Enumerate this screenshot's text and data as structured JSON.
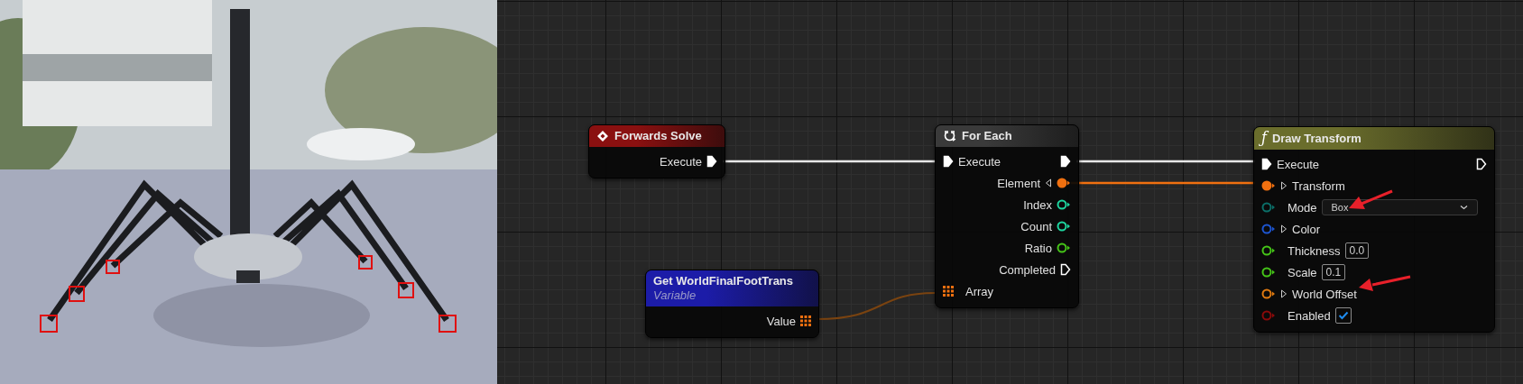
{
  "graph": {
    "nodes": [
      {
        "kind": "event",
        "title": "Forwards Solve",
        "color": "#8a1010",
        "rows": [
          {
            "right": {
              "kind": "exec",
              "label": "Execute",
              "connected": true
            }
          }
        ]
      },
      {
        "kind": "variable",
        "title": "Get WorldFinalFootTrans",
        "subtitle": "Variable",
        "color": "#1c1ca8",
        "rows": [
          {
            "right": {
              "kind": "array",
              "label": "Value",
              "connected": true,
              "color": "#f07010"
            }
          }
        ]
      },
      {
        "kind": "loop",
        "title": "For Each",
        "color": "#3a3a3a",
        "rows": [
          {
            "left": {
              "kind": "exec",
              "label": "Execute",
              "connected": true
            },
            "right": {
              "kind": "exec",
              "connected": true
            }
          },
          {
            "right": {
              "kind": "data",
              "label": "Element",
              "connected": true,
              "expanded": false,
              "color": "#f07010"
            }
          },
          {
            "right": {
              "kind": "data",
              "label": "Index",
              "connected": false,
              "color": "#1ed6a0"
            }
          },
          {
            "right": {
              "kind": "data",
              "label": "Count",
              "connected": false,
              "color": "#1ed6a0"
            }
          },
          {
            "right": {
              "kind": "data",
              "label": "Ratio",
              "connected": false,
              "color": "#45c418"
            }
          },
          {
            "right": {
              "kind": "exec",
              "label": "Completed",
              "connected": false
            }
          },
          {
            "left": {
              "kind": "array",
              "label": "Array",
              "connected": true,
              "color": "#f07010"
            }
          }
        ]
      },
      {
        "kind": "function",
        "glyph": "ƒ",
        "title": "Draw Transform",
        "color": "#6a6d2c",
        "rows": [
          {
            "left": {
              "kind": "exec",
              "label": "Execute",
              "connected": true
            },
            "right": {
              "kind": "exec",
              "connected": false
            }
          },
          {
            "left": {
              "kind": "data",
              "label": "Transform",
              "connected": true,
              "expanded": false,
              "color": "#f07010"
            }
          },
          {
            "left": {
              "kind": "data",
              "label": "Mode",
              "connected": false,
              "color": "#0b6e68",
              "dropdown": "Box"
            }
          },
          {
            "left": {
              "kind": "data",
              "label": "Color",
              "connected": false,
              "expanded": false,
              "color": "#1d55d0"
            }
          },
          {
            "left": {
              "kind": "data",
              "label": "Thickness",
              "connected": false,
              "color": "#45c418",
              "value": "0.0"
            }
          },
          {
            "left": {
              "kind": "data",
              "label": "Scale",
              "connected": false,
              "color": "#45c418",
              "value": "0.1"
            }
          },
          {
            "left": {
              "kind": "data",
              "label": "World Offset",
              "connected": false,
              "expanded": false,
              "color": "#e07a10"
            }
          },
          {
            "left": {
              "kind": "data",
              "label": "Enabled",
              "connected": false,
              "color": "#8a0a0a",
              "checked": true
            }
          }
        ]
      }
    ]
  }
}
